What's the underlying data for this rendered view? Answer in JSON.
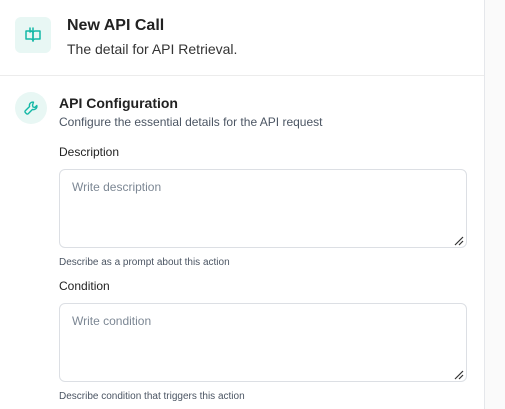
{
  "header": {
    "icon": "book-icon",
    "title": "New API Call",
    "subtitle": "The detail for API Retrieval."
  },
  "section": {
    "icon": "wrench-icon",
    "title": "API Configuration",
    "subtitle": "Configure the essential details for the API request"
  },
  "fields": {
    "description": {
      "label": "Description",
      "placeholder": "Write description",
      "value": "",
      "hint": "Describe as a prompt about this action"
    },
    "condition": {
      "label": "Condition",
      "placeholder": "Write condition",
      "value": "",
      "hint": "Describe condition that triggers this action"
    }
  },
  "colors": {
    "accent": "#14b8a6",
    "accent_bg": "#e8f7f4"
  }
}
